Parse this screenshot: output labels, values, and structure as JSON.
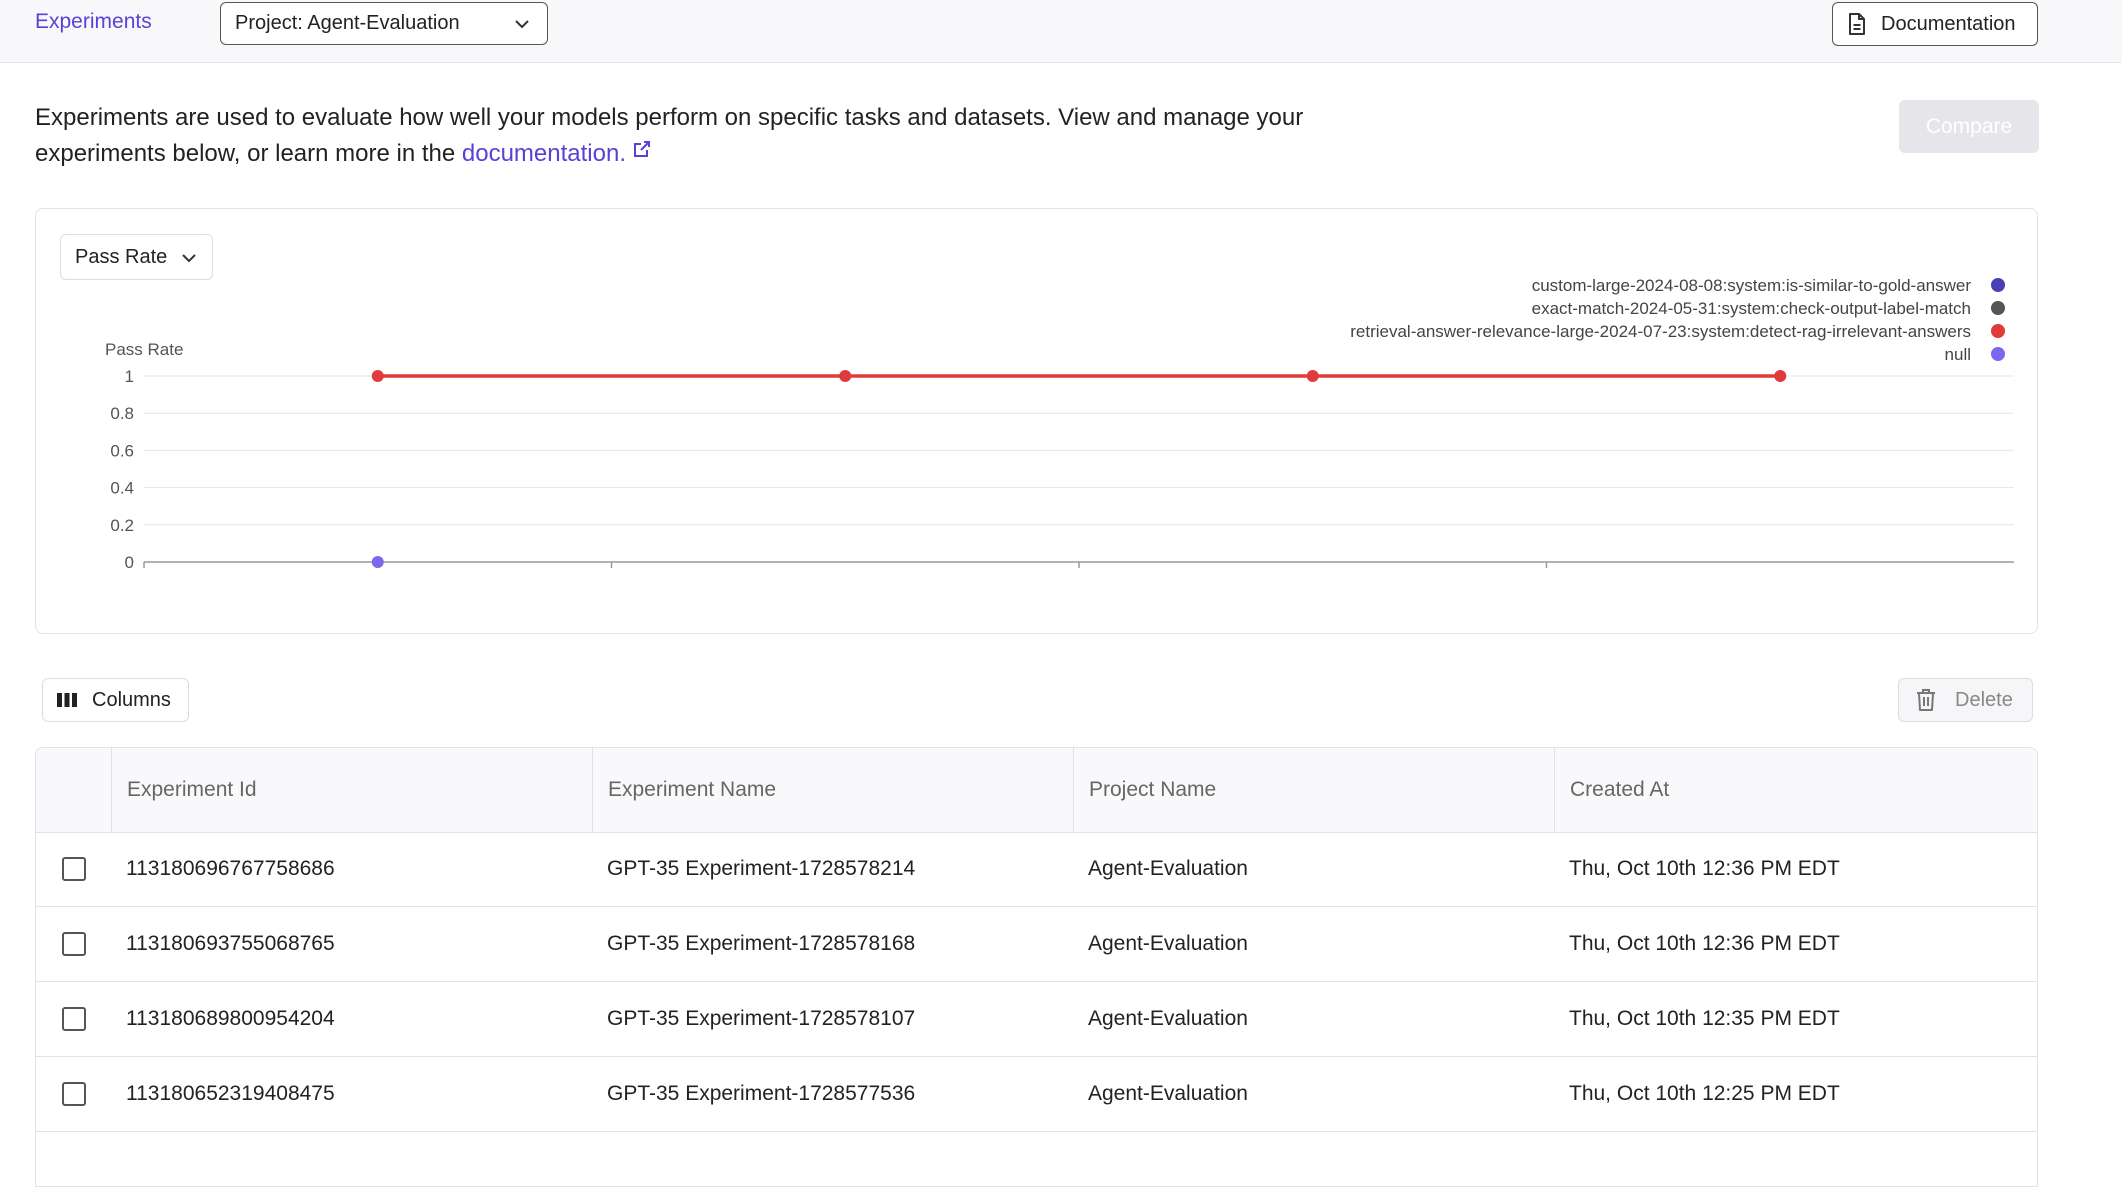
{
  "topbar": {
    "nav_experiments": "Experiments",
    "project_select": "Project: Agent-Evaluation",
    "documentation_button": "Documentation"
  },
  "intro": {
    "text_before": "Experiments are used to evaluate how well your models perform on specific tasks and datasets. View and manage your experiments below, or learn more in the ",
    "link_text": "documentation."
  },
  "compare_button": "Compare",
  "chart": {
    "metric_select": "Pass Rate"
  },
  "chart_data": {
    "type": "line",
    "ylabel": "Pass Rate",
    "ylim": [
      0,
      1
    ],
    "yticks": [
      "1",
      "0.8",
      "0.6",
      "0.4",
      "0.2",
      "0"
    ],
    "grid": true,
    "legend_position": "top-right",
    "series": [
      {
        "name": "custom-large-2024-08-08:system:is-similar-to-gold-answer",
        "color": "#4b3fb8",
        "values": []
      },
      {
        "name": "exact-match-2024-05-31:system:check-output-label-match",
        "color": "#555555",
        "values": []
      },
      {
        "name": "retrieval-answer-relevance-large-2024-07-23:system:detect-rag-irrelevant-answers",
        "color": "#e03a3a",
        "values": [
          1,
          1,
          1,
          1
        ]
      },
      {
        "name": "null",
        "color": "#7b68ee",
        "values": [
          0
        ]
      }
    ]
  },
  "table_toolbar": {
    "columns_button": "Columns",
    "delete_button": "Delete"
  },
  "table": {
    "headers": [
      "Experiment Id",
      "Experiment Name",
      "Project Name",
      "Created At"
    ],
    "rows": [
      {
        "id": "113180696767758686",
        "name": "GPT-35 Experiment-1728578214",
        "project": "Agent-Evaluation",
        "created": "Thu, Oct 10th 12:36 PM EDT"
      },
      {
        "id": "113180693755068765",
        "name": "GPT-35 Experiment-1728578168",
        "project": "Agent-Evaluation",
        "created": "Thu, Oct 10th 12:36 PM EDT"
      },
      {
        "id": "113180689800954204",
        "name": "GPT-35 Experiment-1728578107",
        "project": "Agent-Evaluation",
        "created": "Thu, Oct 10th 12:35 PM EDT"
      },
      {
        "id": "113180652319408475",
        "name": "GPT-35 Experiment-1728577536",
        "project": "Agent-Evaluation",
        "created": "Thu, Oct 10th 12:25 PM EDT"
      }
    ]
  },
  "colors": {
    "accent": "#5b3fd6",
    "series_red": "#e03a3a"
  }
}
